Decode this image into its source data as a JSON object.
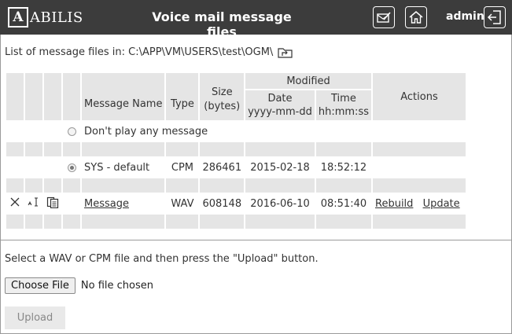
{
  "header": {
    "logo_letter": "A",
    "logo_text": "ABILIS",
    "title": "Voice mail message files",
    "username": "admin"
  },
  "path": {
    "label": "List of message files in: C:\\APP\\VM\\USERS\\test\\OGM\\"
  },
  "table": {
    "headers": {
      "name": "Message Name",
      "type": "Type",
      "size": "Size (bytes)",
      "modified": "Modified",
      "date": "Date",
      "date_format": "yyyy-mm-dd",
      "time": "Time",
      "time_format": "hh:mm:ss",
      "actions": "Actions"
    },
    "rows": [
      {
        "name": "Don't play any message",
        "type": "",
        "size": "",
        "date": "",
        "time": "",
        "selected": false
      },
      {
        "name": "SYS - default",
        "type": "CPM",
        "size": "286461",
        "date": "2015-02-18",
        "time": "18:52:12",
        "selected": true
      },
      {
        "name": "Message",
        "type": "WAV",
        "size": "608148",
        "date": "2016-06-10",
        "time": "08:51:40",
        "action_rebuild": "Rebuild",
        "action_update": "Update"
      }
    ]
  },
  "upload": {
    "hint": "Select a WAV or CPM file and then press the \"Upload\" button.",
    "choose_label": "Choose File",
    "no_file": "No file chosen",
    "upload_label": "Upload"
  },
  "icons": {
    "folder_up": "folder-up-icon",
    "delete": "delete-icon",
    "rename": "rename-icon",
    "copy": "copy-icon",
    "note": "note-icon",
    "home": "home-icon",
    "logout": "logout-icon"
  }
}
